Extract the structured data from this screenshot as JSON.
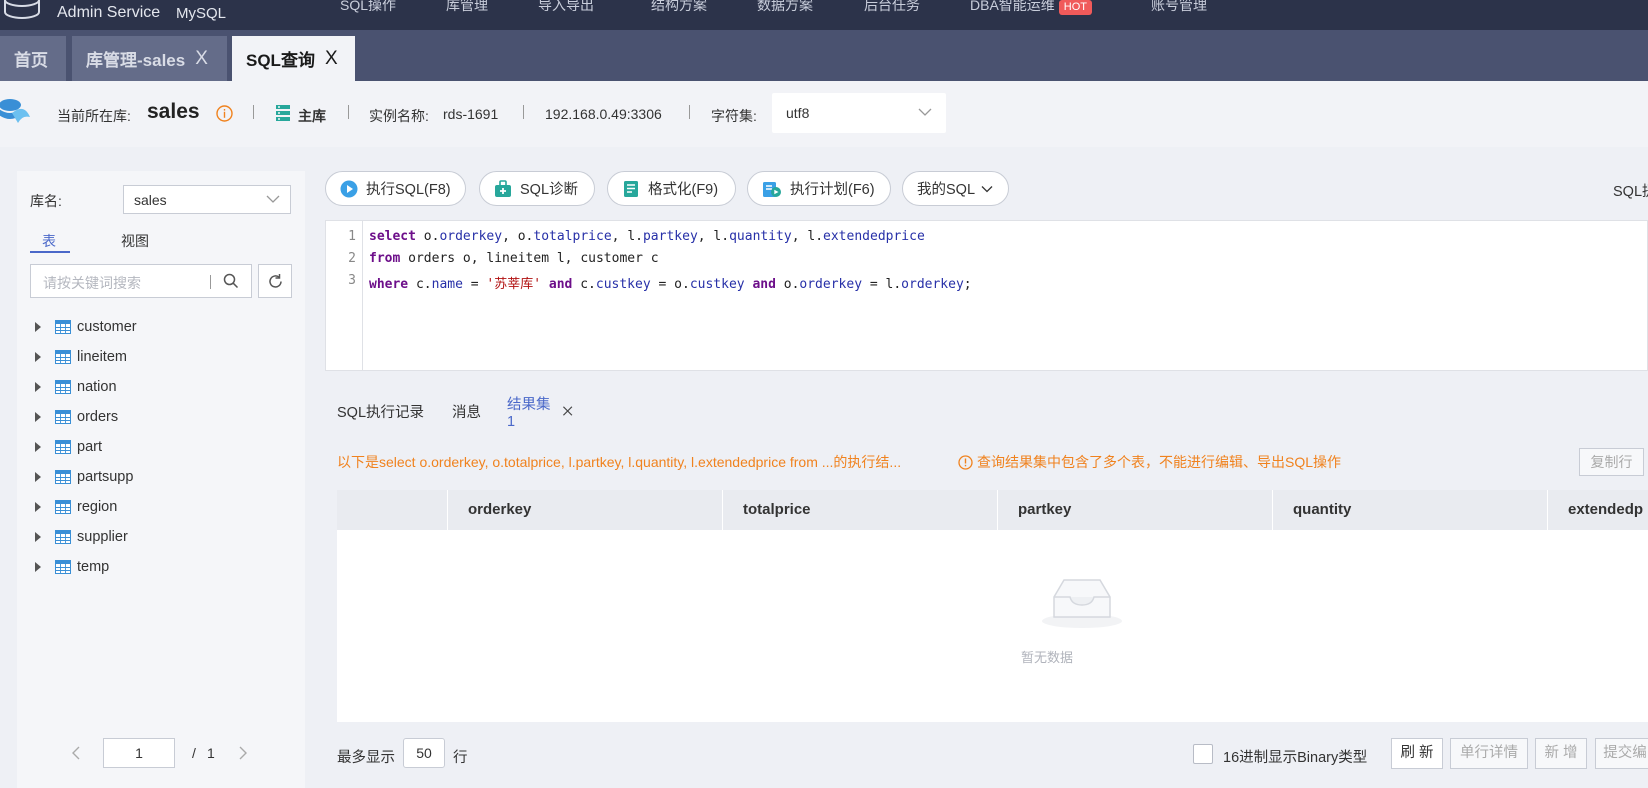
{
  "topnav": {
    "brand": "Admin Service",
    "db_type": "MySQL",
    "menu": [
      "SQL操作",
      "库管理",
      "导入导出",
      "结构方案",
      "数据方案",
      "后台任务",
      "DBA智能运维",
      "账号管理"
    ],
    "hot_badge": "HOT"
  },
  "tabs": [
    {
      "label": "首页"
    },
    {
      "label": "库管理-sales",
      "close": "X"
    },
    {
      "label": "SQL查询",
      "close": "X"
    }
  ],
  "dbinfo": {
    "current_label": "当前所在库:",
    "db_name": "sales",
    "role": "主库",
    "instance_label": "实例名称:",
    "instance_name": "rds-1691",
    "address": "192.168.0.49:3306",
    "charset_label": "字符集:",
    "charset": "utf8"
  },
  "left": {
    "db_label": "库名:",
    "db_select": "sales",
    "tab_tables": "表",
    "tab_views": "视图",
    "search_placeholder": "请按关键词搜索",
    "tables": [
      "customer",
      "lineitem",
      "nation",
      "orders",
      "part",
      "partsupp",
      "region",
      "supplier",
      "temp"
    ],
    "page_current": "1",
    "page_sep": "/",
    "page_total": "1"
  },
  "toolbar": {
    "execute": "执行SQL(F8)",
    "diagnose": "SQL诊断",
    "format": "格式化(F9)",
    "plan": "执行计划(F6)",
    "my_sql": "我的SQL",
    "right_cut": "SQL提"
  },
  "editor": {
    "line_numbers": [
      "1",
      "2",
      "3"
    ],
    "lines": [
      "select o.orderkey, o.totalprice, l.partkey, l.quantity, l.extendedprice",
      "from orders o, lineitem l, customer c",
      "where c.name = '苏莘库' and c.custkey = o.custkey and o.orderkey = l.orderkey;"
    ]
  },
  "result_tabs": {
    "history": "SQL执行记录",
    "messages": "消息",
    "resultset": "结果集1",
    "close": "X"
  },
  "result": {
    "info": "以下是select o.orderkey, o.totalprice, l.partkey, l.quantity, l.extendedprice from ...的执行结...",
    "warning": "查询结果集中包含了多个表，不能进行编辑、导出SQL操作",
    "copy_row": "复制行",
    "columns": [
      "orderkey",
      "totalprice",
      "partkey",
      "quantity",
      "extendedp"
    ],
    "empty": "暂无数据",
    "max_show": "最多显示",
    "max_rows": "50",
    "rows_unit": "行",
    "binary_hex": "16进制显示Binary类型",
    "refresh": "刷 新",
    "row_detail": "单行详情",
    "add": "新 增",
    "submit": "提交编"
  },
  "colors": {
    "nav_bg": "#2c334a",
    "tabs_bg": "#4a5270",
    "accent": "#4a68c9",
    "warning": "#f0821e",
    "hot": "#f05a5a"
  }
}
